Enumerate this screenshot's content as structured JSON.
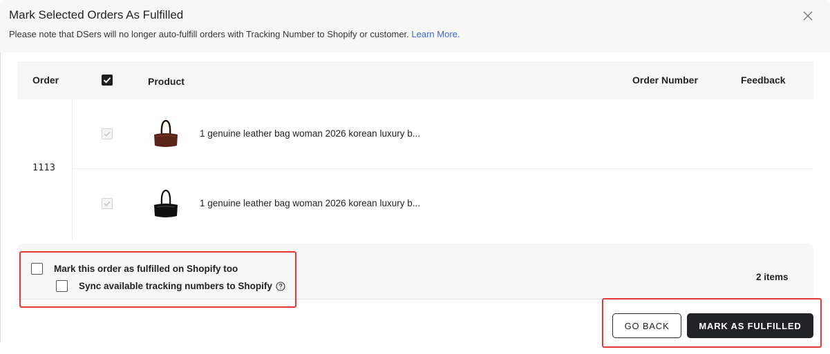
{
  "dialog": {
    "title": "Mark Selected Orders As Fulfilled",
    "notice_text": "Please note that DSers will no longer auto-fulfill orders with Tracking Number to Shopify or customer.",
    "notice_link": "Learn More."
  },
  "table": {
    "headers": {
      "order": "Order",
      "product": "Product",
      "order_number": "Order Number",
      "feedback": "Feedback"
    },
    "order": {
      "number": "1113",
      "items": [
        {
          "name": "1 genuine leather bag woman 2026 korean luxury b...",
          "checked": true,
          "thumb_color": "#5a2418",
          "icon": "brown-bag-thumbnail"
        },
        {
          "name": "1 genuine leather bag woman 2026 korean luxury b...",
          "checked": true,
          "thumb_color": "#111111",
          "icon": "black-bag-thumbnail"
        }
      ]
    }
  },
  "options": {
    "mark_shopify": "Mark this order as fulfilled on Shopify too",
    "sync_tracking": "Sync available tracking numbers to Shopify",
    "items_count": "2  items"
  },
  "actions": {
    "go_back": "GO BACK",
    "mark_fulfilled": "MARK AS FULFILLED"
  },
  "colors": {
    "link": "#3a66e0",
    "primary_button": "#222326",
    "highlight": "#e53935"
  }
}
